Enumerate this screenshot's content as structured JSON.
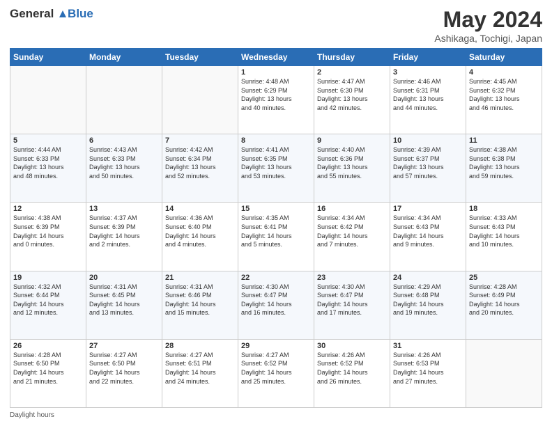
{
  "header": {
    "logo_line1": "General",
    "logo_line2": "Blue",
    "title": "May 2024",
    "subtitle": "Ashikaga, Tochigi, Japan"
  },
  "days_of_week": [
    "Sunday",
    "Monday",
    "Tuesday",
    "Wednesday",
    "Thursday",
    "Friday",
    "Saturday"
  ],
  "weeks": [
    [
      {
        "day": "",
        "info": ""
      },
      {
        "day": "",
        "info": ""
      },
      {
        "day": "",
        "info": ""
      },
      {
        "day": "1",
        "info": "Sunrise: 4:48 AM\nSunset: 6:29 PM\nDaylight: 13 hours\nand 40 minutes."
      },
      {
        "day": "2",
        "info": "Sunrise: 4:47 AM\nSunset: 6:30 PM\nDaylight: 13 hours\nand 42 minutes."
      },
      {
        "day": "3",
        "info": "Sunrise: 4:46 AM\nSunset: 6:31 PM\nDaylight: 13 hours\nand 44 minutes."
      },
      {
        "day": "4",
        "info": "Sunrise: 4:45 AM\nSunset: 6:32 PM\nDaylight: 13 hours\nand 46 minutes."
      }
    ],
    [
      {
        "day": "5",
        "info": "Sunrise: 4:44 AM\nSunset: 6:33 PM\nDaylight: 13 hours\nand 48 minutes."
      },
      {
        "day": "6",
        "info": "Sunrise: 4:43 AM\nSunset: 6:33 PM\nDaylight: 13 hours\nand 50 minutes."
      },
      {
        "day": "7",
        "info": "Sunrise: 4:42 AM\nSunset: 6:34 PM\nDaylight: 13 hours\nand 52 minutes."
      },
      {
        "day": "8",
        "info": "Sunrise: 4:41 AM\nSunset: 6:35 PM\nDaylight: 13 hours\nand 53 minutes."
      },
      {
        "day": "9",
        "info": "Sunrise: 4:40 AM\nSunset: 6:36 PM\nDaylight: 13 hours\nand 55 minutes."
      },
      {
        "day": "10",
        "info": "Sunrise: 4:39 AM\nSunset: 6:37 PM\nDaylight: 13 hours\nand 57 minutes."
      },
      {
        "day": "11",
        "info": "Sunrise: 4:38 AM\nSunset: 6:38 PM\nDaylight: 13 hours\nand 59 minutes."
      }
    ],
    [
      {
        "day": "12",
        "info": "Sunrise: 4:38 AM\nSunset: 6:39 PM\nDaylight: 14 hours\nand 0 minutes."
      },
      {
        "day": "13",
        "info": "Sunrise: 4:37 AM\nSunset: 6:39 PM\nDaylight: 14 hours\nand 2 minutes."
      },
      {
        "day": "14",
        "info": "Sunrise: 4:36 AM\nSunset: 6:40 PM\nDaylight: 14 hours\nand 4 minutes."
      },
      {
        "day": "15",
        "info": "Sunrise: 4:35 AM\nSunset: 6:41 PM\nDaylight: 14 hours\nand 5 minutes."
      },
      {
        "day": "16",
        "info": "Sunrise: 4:34 AM\nSunset: 6:42 PM\nDaylight: 14 hours\nand 7 minutes."
      },
      {
        "day": "17",
        "info": "Sunrise: 4:34 AM\nSunset: 6:43 PM\nDaylight: 14 hours\nand 9 minutes."
      },
      {
        "day": "18",
        "info": "Sunrise: 4:33 AM\nSunset: 6:43 PM\nDaylight: 14 hours\nand 10 minutes."
      }
    ],
    [
      {
        "day": "19",
        "info": "Sunrise: 4:32 AM\nSunset: 6:44 PM\nDaylight: 14 hours\nand 12 minutes."
      },
      {
        "day": "20",
        "info": "Sunrise: 4:31 AM\nSunset: 6:45 PM\nDaylight: 14 hours\nand 13 minutes."
      },
      {
        "day": "21",
        "info": "Sunrise: 4:31 AM\nSunset: 6:46 PM\nDaylight: 14 hours\nand 15 minutes."
      },
      {
        "day": "22",
        "info": "Sunrise: 4:30 AM\nSunset: 6:47 PM\nDaylight: 14 hours\nand 16 minutes."
      },
      {
        "day": "23",
        "info": "Sunrise: 4:30 AM\nSunset: 6:47 PM\nDaylight: 14 hours\nand 17 minutes."
      },
      {
        "day": "24",
        "info": "Sunrise: 4:29 AM\nSunset: 6:48 PM\nDaylight: 14 hours\nand 19 minutes."
      },
      {
        "day": "25",
        "info": "Sunrise: 4:28 AM\nSunset: 6:49 PM\nDaylight: 14 hours\nand 20 minutes."
      }
    ],
    [
      {
        "day": "26",
        "info": "Sunrise: 4:28 AM\nSunset: 6:50 PM\nDaylight: 14 hours\nand 21 minutes."
      },
      {
        "day": "27",
        "info": "Sunrise: 4:27 AM\nSunset: 6:50 PM\nDaylight: 14 hours\nand 22 minutes."
      },
      {
        "day": "28",
        "info": "Sunrise: 4:27 AM\nSunset: 6:51 PM\nDaylight: 14 hours\nand 24 minutes."
      },
      {
        "day": "29",
        "info": "Sunrise: 4:27 AM\nSunset: 6:52 PM\nDaylight: 14 hours\nand 25 minutes."
      },
      {
        "day": "30",
        "info": "Sunrise: 4:26 AM\nSunset: 6:52 PM\nDaylight: 14 hours\nand 26 minutes."
      },
      {
        "day": "31",
        "info": "Sunrise: 4:26 AM\nSunset: 6:53 PM\nDaylight: 14 hours\nand 27 minutes."
      },
      {
        "day": "",
        "info": ""
      }
    ]
  ],
  "footer": {
    "daylight_label": "Daylight hours"
  }
}
